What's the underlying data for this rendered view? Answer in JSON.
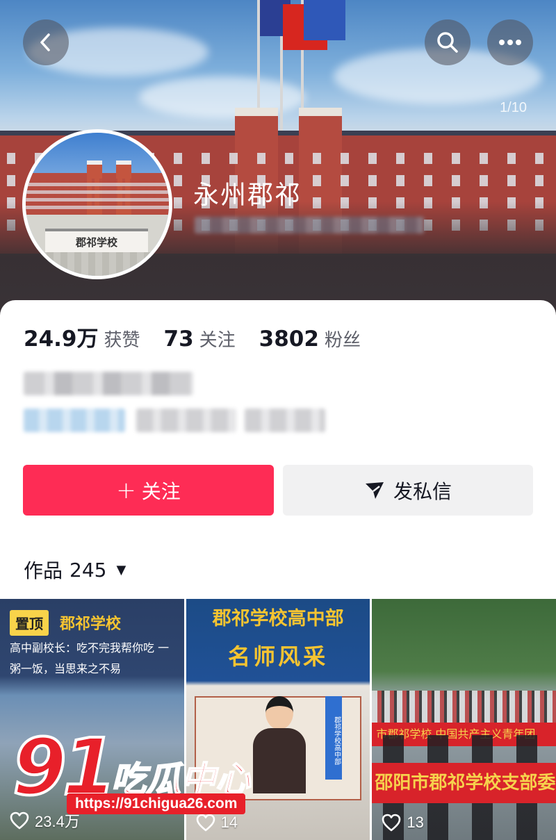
{
  "header": {
    "back_icon": "chevron-left-icon",
    "search_icon": "search-icon",
    "more_icon": "more-horizontal-icon",
    "photo_counter": "1/10",
    "avatar_sign": "郡祁学校"
  },
  "profile": {
    "nickname": "永州郡祁"
  },
  "stats": {
    "likes_value": "24.9万",
    "likes_label": "获赞",
    "following_value": "73",
    "following_label": "关注",
    "followers_value": "3802",
    "followers_label": "粉丝"
  },
  "actions": {
    "follow_plus": "+",
    "follow_label": "关注",
    "message_label": "发私信",
    "accent_color": "#fe2c55"
  },
  "works": {
    "label": "作品",
    "count": "245",
    "caret": "▼"
  },
  "videos": [
    {
      "pin_label": "置顶",
      "title": "郡祁学校",
      "subtitle": "高中副校长：吃不完我帮你吃 一粥一饭，当思来之不易",
      "likes": "23.4万"
    },
    {
      "title_line1": "郡祁学校高中部",
      "title_line2": "名师风采",
      "sign_text": "郡祁学校高中部",
      "likes": "14"
    },
    {
      "banner_text": "邵阳市郡祁学校支部委",
      "banner_small": "市郡祁学校  中国共产主义青年团",
      "likes": "13"
    }
  ],
  "watermark": {
    "number": "91",
    "text": "吃瓜中心",
    "url": "https://91chigua26.com"
  }
}
